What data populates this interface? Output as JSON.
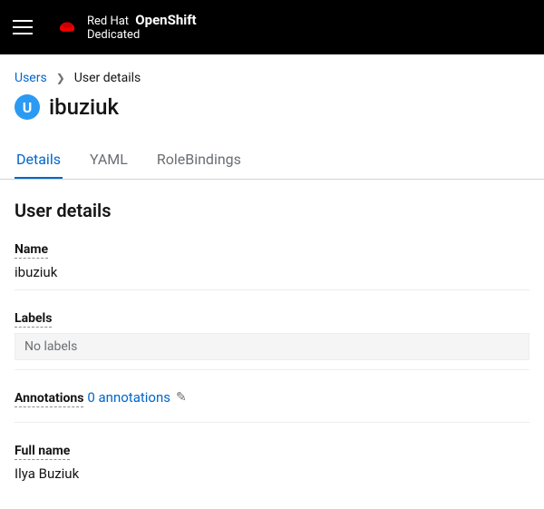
{
  "brand": {
    "company": "Red Hat",
    "product": "OpenShift",
    "edition": "Dedicated"
  },
  "breadcrumb": {
    "root": "Users",
    "current": "User details"
  },
  "page": {
    "badge_letter": "U",
    "title": "ibuziuk"
  },
  "tabs": [
    {
      "label": "Details"
    },
    {
      "label": "YAML"
    },
    {
      "label": "RoleBindings"
    }
  ],
  "section": {
    "heading": "User details",
    "fields": {
      "name_label": "Name",
      "name_value": "ibuziuk",
      "labels_label": "Labels",
      "labels_empty": "No labels",
      "annotations_label": "Annotations",
      "annotations_link": "0 annotations",
      "fullname_label": "Full name",
      "fullname_value": "Ilya Buziuk"
    }
  }
}
